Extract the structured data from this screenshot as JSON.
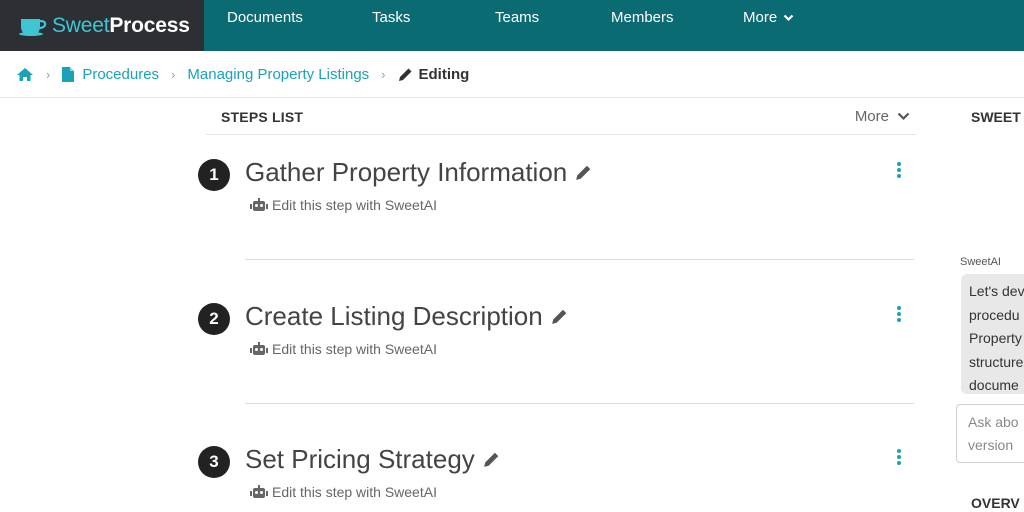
{
  "app": {
    "brand_sweet": "Sweet",
    "brand_process": "Process"
  },
  "nav": {
    "items": [
      "Documents",
      "Tasks",
      "Teams",
      "Members"
    ],
    "more_label": "More"
  },
  "breadcrumb": {
    "procedures": "Procedures",
    "procedure_name": "Managing Property Listings",
    "current": "Editing"
  },
  "steps_list": {
    "title": "STEPS LIST",
    "more_label": "More",
    "steps": [
      {
        "number": "1",
        "title": "Gather Property Information",
        "ai_label": "Edit this step with SweetAI"
      },
      {
        "number": "2",
        "title": "Create Listing Description",
        "ai_label": "Edit this step with SweetAI"
      },
      {
        "number": "3",
        "title": "Set Pricing Strategy",
        "ai_label": "Edit this step with SweetAI"
      }
    ]
  },
  "right_panel": {
    "title": "SWEET",
    "ai_label": "SweetAI",
    "bubble_lines": [
      "Let's dev",
      "procedu",
      "Property",
      "structure",
      "docume"
    ],
    "input_lines": [
      "Ask abo",
      "version"
    ],
    "overview": "OVERV"
  },
  "colors": {
    "nav_bg": "#0a6b73",
    "brand_bg": "#2c2f33",
    "accent": "#1aa3b8",
    "kebab": "#1aa3b8"
  }
}
